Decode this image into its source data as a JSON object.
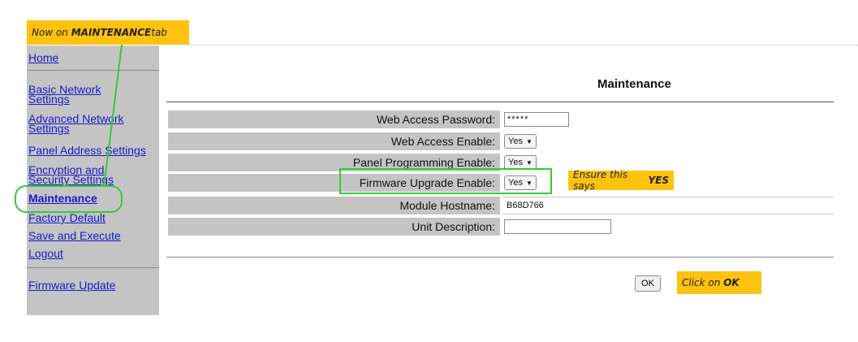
{
  "callouts": {
    "tab_prefix": "Now on ",
    "tab_bold": "MAINTENANCE",
    "tab_suffix": " tab",
    "yes_prefix": "Ensure this says ",
    "yes_bold": "YES",
    "ok_prefix": "Click on ",
    "ok_bold": "OK"
  },
  "sidebar": {
    "items": [
      {
        "label": "Home"
      },
      {
        "label": "Basic Network Settings"
      },
      {
        "label": "Advanced Network Settings"
      },
      {
        "label": "Panel Address Settings"
      },
      {
        "label": "Encryption and Security Settings"
      },
      {
        "label": "Maintenance",
        "active": true
      },
      {
        "label": "Factory Default"
      },
      {
        "label": "Save and Execute"
      },
      {
        "label": "Logout"
      },
      {
        "label": "Firmware Update"
      }
    ]
  },
  "main": {
    "title": "Maintenance",
    "fields": [
      {
        "label": "Web Access Password:",
        "value": "*****",
        "kind": "password"
      },
      {
        "label": "Web Access Enable:",
        "value": "Yes",
        "kind": "select"
      },
      {
        "label": "Panel Programming Enable:",
        "value": "Yes",
        "kind": "select"
      },
      {
        "label": "Firmware Upgrade Enable:",
        "value": "Yes",
        "kind": "select"
      },
      {
        "label": "Module Hostname:",
        "value": "B68D766",
        "kind": "text"
      },
      {
        "label": "Unit Description:",
        "value": "",
        "kind": "text"
      }
    ],
    "ok_label": "OK"
  },
  "colors": {
    "callout": "#ffc20e",
    "highlight": "#33cc33",
    "link": "#1a1acc",
    "panel": "#c4c4c4"
  },
  "icons": [
    "chevron-down-icon"
  ]
}
